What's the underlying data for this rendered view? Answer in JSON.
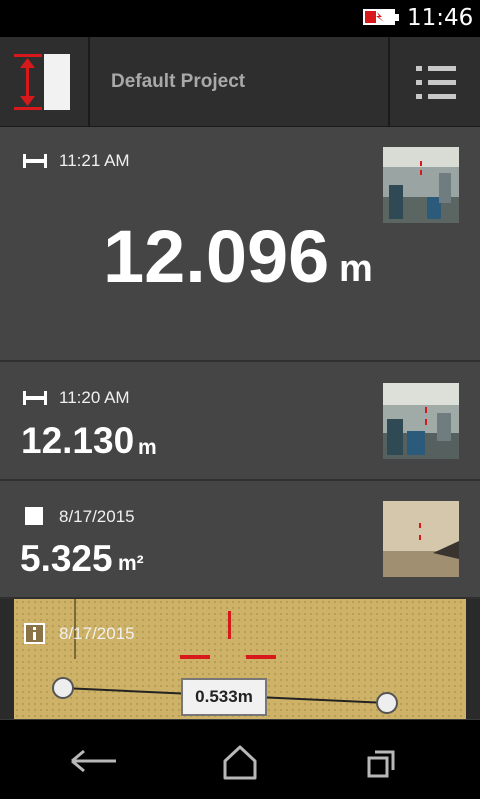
{
  "status_bar": {
    "time": "11:46",
    "battery_icon": "battery-charging-icon"
  },
  "header": {
    "project_title": "Default Project",
    "logo_icon": "distance-logo-icon",
    "menu_icon": "list-menu-icon"
  },
  "measurements": [
    {
      "type_icon": "distance-icon",
      "time": "11:21 AM",
      "value": "12.096",
      "unit": "m"
    },
    {
      "type_icon": "distance-icon",
      "time": "11:20 AM",
      "value": "12.130",
      "unit": "m"
    },
    {
      "type_icon": "area-icon",
      "time": "8/17/2015",
      "value": "5.325",
      "unit": "m²"
    },
    {
      "type_icon": "photo-measure-icon",
      "time": "8/17/2015",
      "measure_label": "0.533m"
    }
  ],
  "nav": {
    "back": "back-icon",
    "home": "home-icon",
    "recents": "recents-icon"
  },
  "colors": {
    "accent": "#d7191c",
    "background": "#454545",
    "header": "#2e2e2e"
  }
}
